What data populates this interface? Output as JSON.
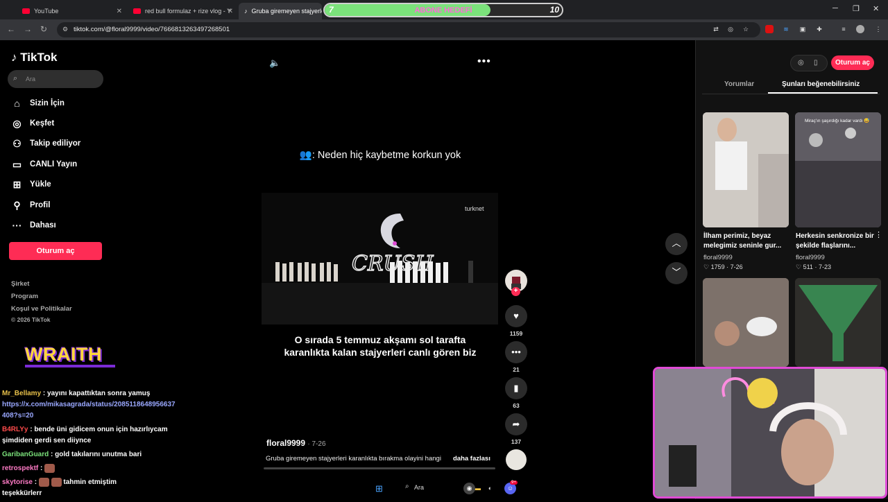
{
  "browser": {
    "tabs": [
      {
        "title": "YouTube"
      },
      {
        "title": "red bull formulaz + rize vlog - Y"
      },
      {
        "title": "Gruba giremeyen stajyerleri"
      }
    ],
    "url": "tiktok.com/@floral9999/video/7666813263497268501"
  },
  "subscriber_goal": {
    "label": "ABONE HEDEFİ",
    "current": "7",
    "target": "10",
    "progress": 0.7
  },
  "tiktok": {
    "logo": "TikTok",
    "search_placeholder": "Ara",
    "nav": [
      "Sizin İçin",
      "Keşfet",
      "Takip ediliyor",
      "CANLI Yayın",
      "Yükle",
      "Profil",
      "Dahası"
    ],
    "login": "Oturum aç",
    "footer": [
      "Şirket",
      "Program",
      "Koşul ve Politikalar",
      "© 2026 TikTok"
    ]
  },
  "video": {
    "top_caption": "👥: Neden hiç kaybetme korkun yok",
    "watermark": "turknet",
    "stage_caption_1": "O sırada 5 temmuz akşamı sol tarafta",
    "stage_caption_2": "karanlıkta kalan stajyerleri canlı gören biz",
    "author": "floral9999",
    "date": "· 7-26",
    "description": "Gruba giremeyen stajyerleri karanlıkta bırakma olayini hangi",
    "more": "daha fazlası",
    "likes": "1159",
    "comments": "21",
    "saves": "63",
    "shares": "137"
  },
  "right_panel": {
    "login": "Oturum aç",
    "tab_comments": "Yorumlar",
    "tab_suggested": "Şunları beğenebilirsiniz",
    "cards": [
      {
        "title_1": "İlham perimiz, beyaz",
        "title_2": "melegimiz seninle gur...",
        "user": "floral9999",
        "likes": "1759",
        "date": "7-26"
      },
      {
        "title_1": "Herkesin senkronize bir",
        "title_2": "şekilde flaşlarını...",
        "user": "floral9999",
        "likes": "511",
        "date": "7-23"
      }
    ],
    "card2_overlay": "Miraç'ın şaşırdığı kadar vardı 😅"
  },
  "stream_overlay": {
    "logo": "WRAITH",
    "chat": [
      {
        "user": "Mr_Bellamy",
        "text": ": yayını kapattıktan sonra yamuş"
      },
      {
        "user": "",
        "text": "https://x.com/mikasagrada/status/2085118648956637408?s=20"
      },
      {
        "user": "B4RLYy",
        "text": ": bende üni gidicem onun için hazırlıycam şimdiden gerdi sen diiynce"
      },
      {
        "user": "GaribanGuard",
        "text": ": gold takılarını unutma bari"
      },
      {
        "user": "retrospektf",
        "text": ":"
      },
      {
        "user": "skytorise",
        "text": ":"
      },
      {
        "user": "",
        "text": "tahmin etmiştim"
      },
      {
        "user": "",
        "text": "teşekkürlerr"
      }
    ]
  },
  "taskbar": {
    "search": "Ara",
    "discord_badge": "9+"
  }
}
